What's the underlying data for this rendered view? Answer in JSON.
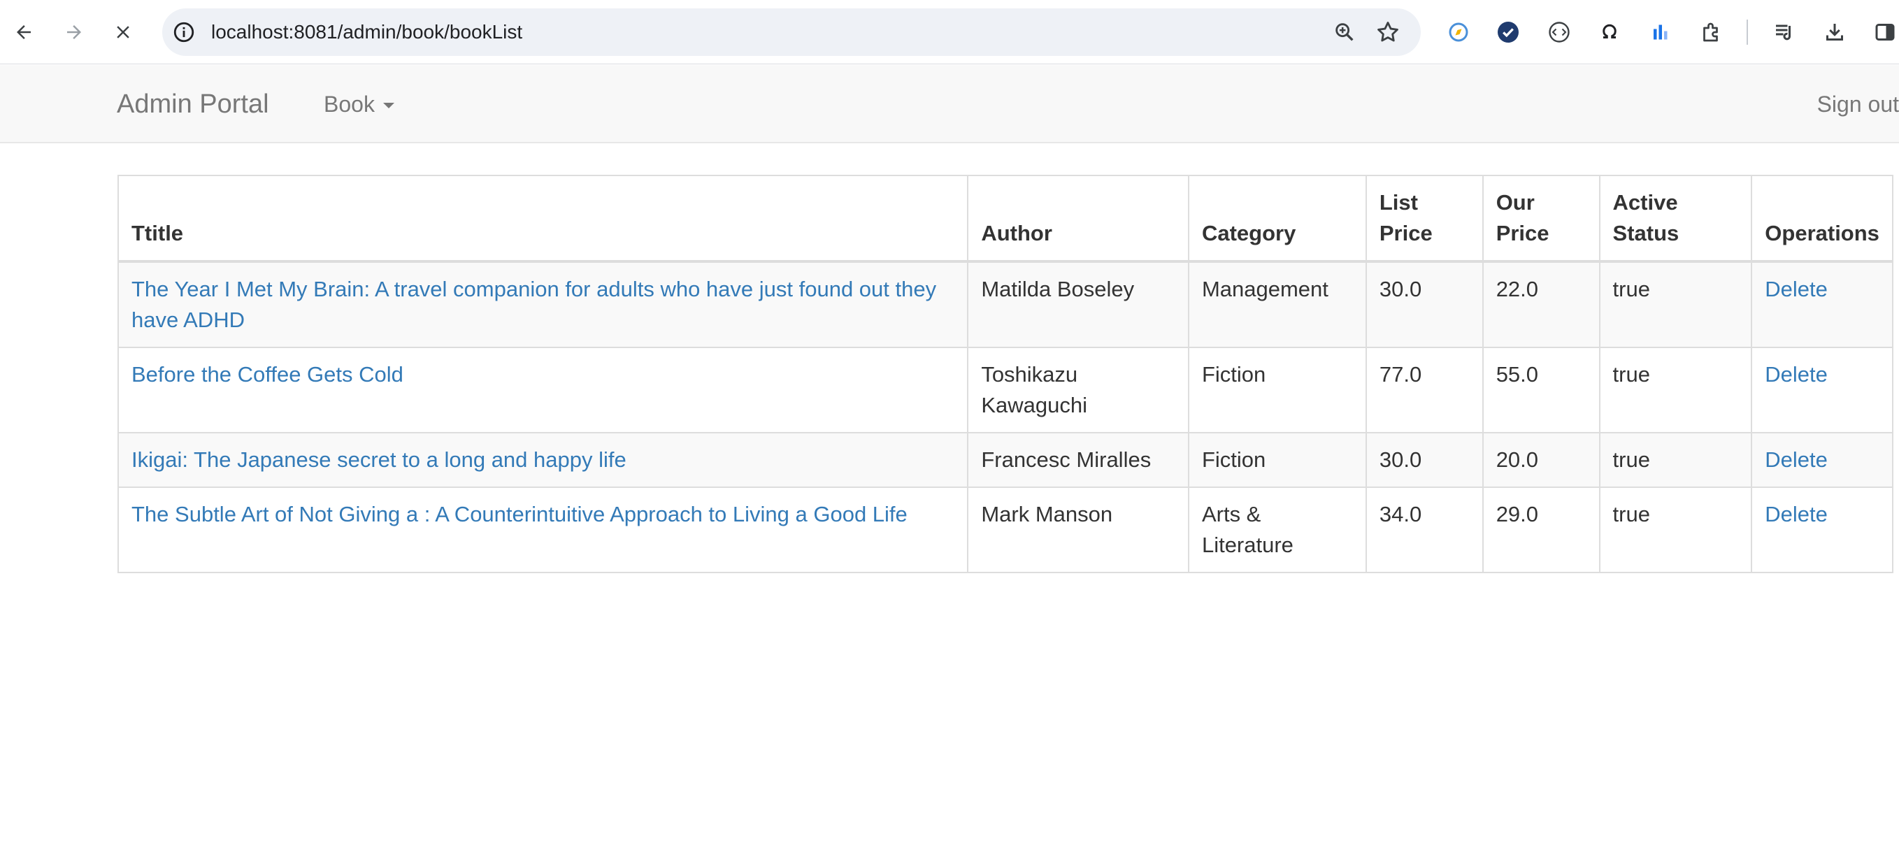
{
  "browser": {
    "url": "localhost:8081/admin/book/bookList"
  },
  "navbar": {
    "brand": "Admin Portal",
    "dropdown_label": "Book",
    "signout_label": "Sign out"
  },
  "table": {
    "headers": {
      "title": "Ttitle",
      "author": "Author",
      "category": "Category",
      "list_price": "List Price",
      "our_price": "Our Price",
      "active_status": "Active Status",
      "operations": "Operations"
    },
    "rows": [
      {
        "title": "The Year I Met My Brain: A travel companion for adults who have just found out they have ADHD",
        "author": "Matilda Boseley",
        "category": "Management",
        "list_price": "30.0",
        "our_price": "22.0",
        "active": "true",
        "operation": "Delete"
      },
      {
        "title": "Before the Coffee Gets Cold",
        "author": "Toshikazu Kawaguchi",
        "category": "Fiction",
        "list_price": "77.0",
        "our_price": "55.0",
        "active": "true",
        "operation": "Delete"
      },
      {
        "title": "Ikigai: The Japanese secret to a long and happy life",
        "author": "Francesc Miralles",
        "category": "Fiction",
        "list_price": "30.0",
        "our_price": "20.0",
        "active": "true",
        "operation": "Delete"
      },
      {
        "title": "The Subtle Art of Not Giving a : A Counterintuitive Approach to Living a Good Life",
        "author": "Mark Manson",
        "category": "Arts & Literature",
        "list_price": "34.0",
        "our_price": "29.0",
        "active": "true",
        "operation": "Delete"
      }
    ]
  },
  "colors": {
    "link": "#337ab7",
    "navbar_bg": "#f8f8f8",
    "navbar_text": "#777777",
    "stripe": "#f9f9f9"
  },
  "icons": {
    "back": "arrow-left-icon",
    "forward": "arrow-right-icon",
    "stop": "close-icon",
    "site_info": "info-icon",
    "zoom": "zoom-icon",
    "bookmark": "star-icon"
  }
}
